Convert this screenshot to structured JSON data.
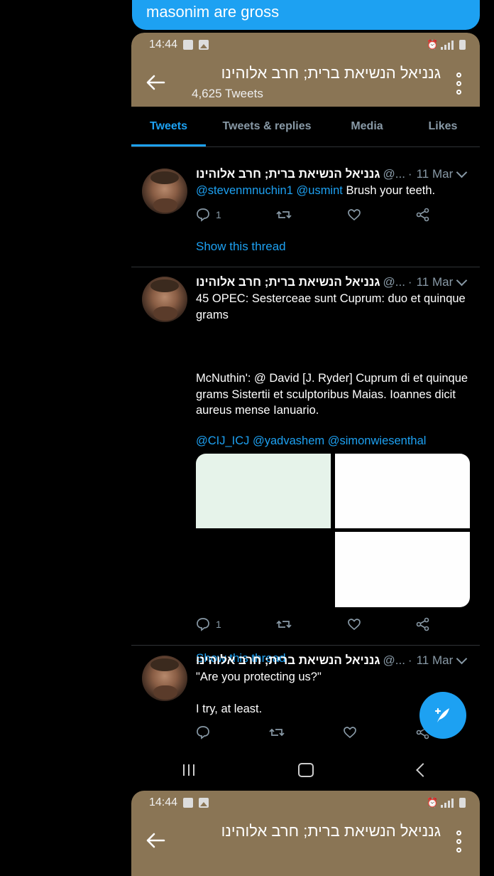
{
  "message_bubble": {
    "text": "masonim are gross"
  },
  "status_bar": {
    "time": "14:44"
  },
  "header": {
    "title": "גנניאל הנשיאת ברית; חרב אלוהינו",
    "tweet_count": "4,625 Tweets"
  },
  "tabs": [
    {
      "label": "Tweets",
      "active": true
    },
    {
      "label": "Tweets & replies",
      "active": false
    },
    {
      "label": "Media",
      "active": false
    },
    {
      "label": "Likes",
      "active": false
    }
  ],
  "tweets": [
    {
      "name": "גנניאל הנשיאת ברית; חרב אלוהינו",
      "handle": "@...",
      "date": "11 Mar",
      "mention1": "@stevenmnuchin1",
      "mention2": "@usmint",
      "text": "Brush your teeth.",
      "reply_count": "1",
      "show_thread": "Show this thread"
    },
    {
      "name": "גנניאל הנשיאת ברית; חרב אלוהינו",
      "handle": "@...",
      "date": "11 Mar",
      "para1": "45 OPEC: Sesterceae sunt Cuprum: duo et quinque grams",
      "para2": "McNuthin': @ David [J. Ryder] Cuprum di et quinque grams Sistertii et sculptoribus Maias. Ioannes dicit aureus mense Ianuario.",
      "mentions": "@CIJ_ICJ @yadvashem @simonwiesenthal",
      "reply_count": "1",
      "show_thread": "Show this thread"
    },
    {
      "name": "גנניאל הנשיאת ברית; חרב אלוהינו",
      "handle": "@...",
      "date": "11 Mar",
      "para1": "\"Are you protecting us?\"",
      "para2": "I try, at least."
    }
  ],
  "second_screen": {
    "time": "14:44",
    "title": "גנניאל הנשיאת ברית; חרב אלוהינו"
  },
  "colors": {
    "header_brown": "#8a7555",
    "accent_blue": "#1da1f2",
    "muted_gray": "#8899a6"
  }
}
